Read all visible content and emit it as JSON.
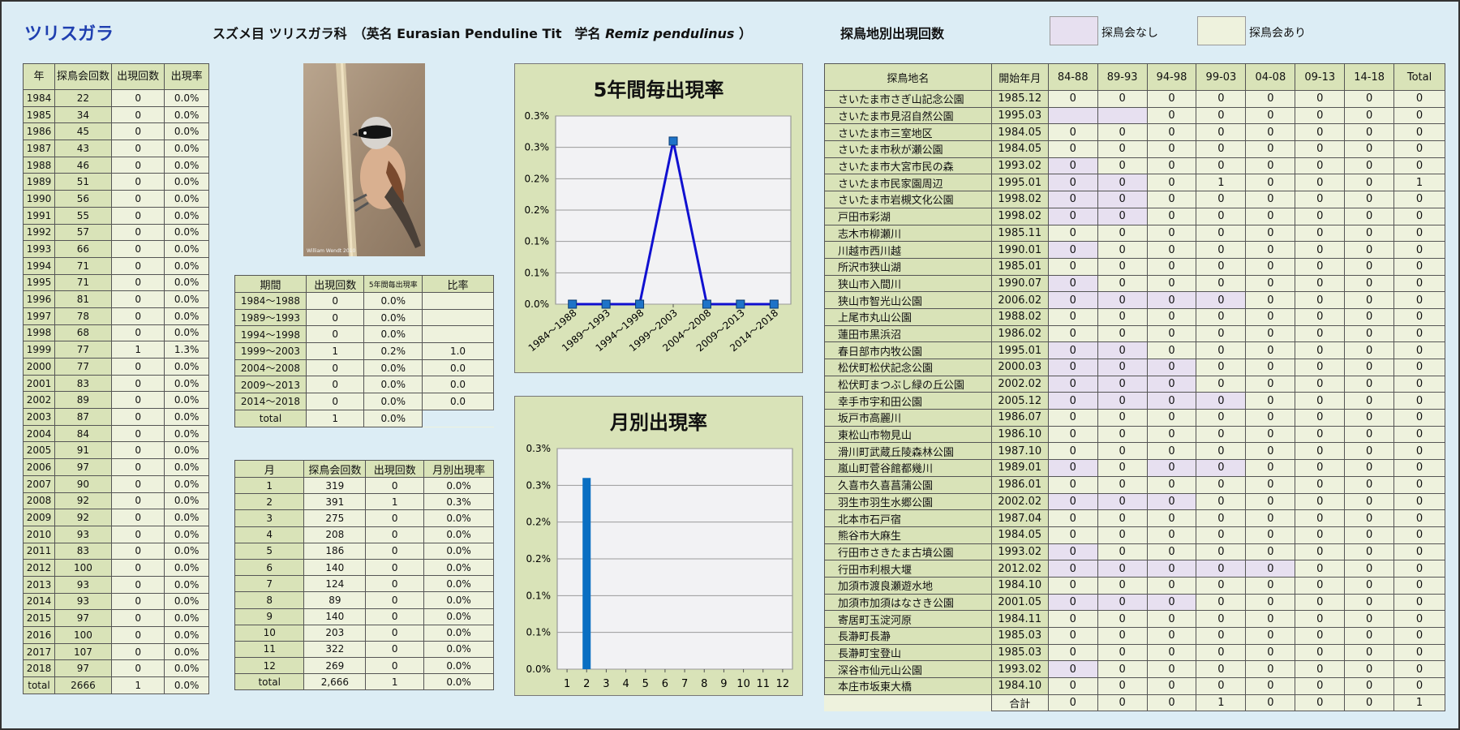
{
  "header": {
    "title": "ツリスガラ",
    "species_prefix": "スズメ目 ツリスガラ科　（英名 Eurasian Penduline Tit　学名",
    "species_latin": "Remiz pendulinus",
    "species_suffix": "）",
    "sites_title": "探鳥地別出現回数",
    "legend_none": "探鳥会なし",
    "legend_yes": "探鳥会あり"
  },
  "colors": {
    "bg": "#dcedf5",
    "cell": "#eef2dd",
    "header": "#d9e3b8",
    "none": "#e7e0f0",
    "line": "#1010d0",
    "bar": "#0a6fc2"
  },
  "photo": {
    "credit": "William Wendt 2010"
  },
  "years_table": {
    "headers": [
      "年",
      "探鳥会回数",
      "出現回数",
      "出現率"
    ],
    "rows": [
      [
        "1984",
        "22",
        "0",
        "0.0%"
      ],
      [
        "1985",
        "34",
        "0",
        "0.0%"
      ],
      [
        "1986",
        "45",
        "0",
        "0.0%"
      ],
      [
        "1987",
        "43",
        "0",
        "0.0%"
      ],
      [
        "1988",
        "46",
        "0",
        "0.0%"
      ],
      [
        "1989",
        "51",
        "0",
        "0.0%"
      ],
      [
        "1990",
        "56",
        "0",
        "0.0%"
      ],
      [
        "1991",
        "55",
        "0",
        "0.0%"
      ],
      [
        "1992",
        "57",
        "0",
        "0.0%"
      ],
      [
        "1993",
        "66",
        "0",
        "0.0%"
      ],
      [
        "1994",
        "71",
        "0",
        "0.0%"
      ],
      [
        "1995",
        "71",
        "0",
        "0.0%"
      ],
      [
        "1996",
        "81",
        "0",
        "0.0%"
      ],
      [
        "1997",
        "78",
        "0",
        "0.0%"
      ],
      [
        "1998",
        "68",
        "0",
        "0.0%"
      ],
      [
        "1999",
        "77",
        "1",
        "1.3%"
      ],
      [
        "2000",
        "77",
        "0",
        "0.0%"
      ],
      [
        "2001",
        "83",
        "0",
        "0.0%"
      ],
      [
        "2002",
        "89",
        "0",
        "0.0%"
      ],
      [
        "2003",
        "87",
        "0",
        "0.0%"
      ],
      [
        "2004",
        "84",
        "0",
        "0.0%"
      ],
      [
        "2005",
        "91",
        "0",
        "0.0%"
      ],
      [
        "2006",
        "97",
        "0",
        "0.0%"
      ],
      [
        "2007",
        "90",
        "0",
        "0.0%"
      ],
      [
        "2008",
        "92",
        "0",
        "0.0%"
      ],
      [
        "2009",
        "92",
        "0",
        "0.0%"
      ],
      [
        "2010",
        "93",
        "0",
        "0.0%"
      ],
      [
        "2011",
        "83",
        "0",
        "0.0%"
      ],
      [
        "2012",
        "100",
        "0",
        "0.0%"
      ],
      [
        "2013",
        "93",
        "0",
        "0.0%"
      ],
      [
        "2014",
        "93",
        "0",
        "0.0%"
      ],
      [
        "2015",
        "97",
        "0",
        "0.0%"
      ],
      [
        "2016",
        "100",
        "0",
        "0.0%"
      ],
      [
        "2017",
        "107",
        "0",
        "0.0%"
      ],
      [
        "2018",
        "97",
        "0",
        "0.0%"
      ],
      [
        "total",
        "2666",
        "1",
        "0.0%"
      ]
    ]
  },
  "period_table": {
    "headers": [
      "期間",
      "出現回数",
      "5年間毎出現率",
      "比率"
    ],
    "rows": [
      [
        "1984～1988",
        "0",
        "0.0%",
        ""
      ],
      [
        "1989～1993",
        "0",
        "0.0%",
        ""
      ],
      [
        "1994～1998",
        "0",
        "0.0%",
        ""
      ],
      [
        "1999～2003",
        "1",
        "0.2%",
        "1.0"
      ],
      [
        "2004～2008",
        "0",
        "0.0%",
        "0.0"
      ],
      [
        "2009～2013",
        "0",
        "0.0%",
        "0.0"
      ],
      [
        "2014～2018",
        "0",
        "0.0%",
        "0.0"
      ]
    ],
    "total": [
      "total",
      "1",
      "0.0%"
    ]
  },
  "month_table": {
    "headers": [
      "月",
      "探鳥会回数",
      "出現回数",
      "月別出現率"
    ],
    "rows": [
      [
        "1",
        "319",
        "0",
        "0.0%"
      ],
      [
        "2",
        "391",
        "1",
        "0.3%"
      ],
      [
        "3",
        "275",
        "0",
        "0.0%"
      ],
      [
        "4",
        "208",
        "0",
        "0.0%"
      ],
      [
        "5",
        "186",
        "0",
        "0.0%"
      ],
      [
        "6",
        "140",
        "0",
        "0.0%"
      ],
      [
        "7",
        "124",
        "0",
        "0.0%"
      ],
      [
        "8",
        "89",
        "0",
        "0.0%"
      ],
      [
        "9",
        "140",
        "0",
        "0.0%"
      ],
      [
        "10",
        "203",
        "0",
        "0.0%"
      ],
      [
        "11",
        "322",
        "0",
        "0.0%"
      ],
      [
        "12",
        "269",
        "0",
        "0.0%"
      ],
      [
        "total",
        "2,666",
        "1",
        "0.0%"
      ]
    ]
  },
  "sites_table": {
    "headers": [
      "探鳥地名",
      "開始年月",
      "84-88",
      "89-93",
      "94-98",
      "99-03",
      "04-08",
      "09-13",
      "14-18",
      "Total"
    ],
    "rows": [
      {
        "name": "さいたま市さぎ山記念公園",
        "start": "1985.12",
        "vals": [
          "0",
          "0",
          "0",
          "0",
          "0",
          "0",
          "0",
          "0"
        ],
        "none": []
      },
      {
        "name": "さいたま市見沼自然公園",
        "start": "1995.03",
        "vals": [
          "",
          "",
          "0",
          "0",
          "0",
          "0",
          "0",
          "0"
        ],
        "none": [
          0,
          1
        ]
      },
      {
        "name": "さいたま市三室地区",
        "start": "1984.05",
        "vals": [
          "0",
          "0",
          "0",
          "0",
          "0",
          "0",
          "0",
          "0"
        ],
        "none": []
      },
      {
        "name": "さいたま市秋が瀬公園",
        "start": "1984.05",
        "vals": [
          "0",
          "0",
          "0",
          "0",
          "0",
          "0",
          "0",
          "0"
        ],
        "none": []
      },
      {
        "name": "さいたま市大宮市民の森",
        "start": "1993.02",
        "vals": [
          "0",
          "0",
          "0",
          "0",
          "0",
          "0",
          "0",
          "0"
        ],
        "none": [
          0
        ]
      },
      {
        "name": "さいたま市民家園周辺",
        "start": "1995.01",
        "vals": [
          "0",
          "0",
          "0",
          "1",
          "0",
          "0",
          "0",
          "1"
        ],
        "none": [
          0,
          1
        ]
      },
      {
        "name": "さいたま市岩槻文化公園",
        "start": "1998.02",
        "vals": [
          "0",
          "0",
          "0",
          "0",
          "0",
          "0",
          "0",
          "0"
        ],
        "none": [
          0,
          1
        ]
      },
      {
        "name": "戸田市彩湖",
        "start": "1998.02",
        "vals": [
          "0",
          "0",
          "0",
          "0",
          "0",
          "0",
          "0",
          "0"
        ],
        "none": [
          0,
          1
        ]
      },
      {
        "name": "志木市柳瀬川",
        "start": "1985.11",
        "vals": [
          "0",
          "0",
          "0",
          "0",
          "0",
          "0",
          "0",
          "0"
        ],
        "none": []
      },
      {
        "name": "川越市西川越",
        "start": "1990.01",
        "vals": [
          "0",
          "0",
          "0",
          "0",
          "0",
          "0",
          "0",
          "0"
        ],
        "none": [
          0
        ]
      },
      {
        "name": "所沢市狭山湖",
        "start": "1985.01",
        "vals": [
          "0",
          "0",
          "0",
          "0",
          "0",
          "0",
          "0",
          "0"
        ],
        "none": []
      },
      {
        "name": "狭山市入間川",
        "start": "1990.07",
        "vals": [
          "0",
          "0",
          "0",
          "0",
          "0",
          "0",
          "0",
          "0"
        ],
        "none": [
          0
        ]
      },
      {
        "name": "狭山市智光山公園",
        "start": "2006.02",
        "vals": [
          "0",
          "0",
          "0",
          "0",
          "0",
          "0",
          "0",
          "0"
        ],
        "none": [
          0,
          1,
          2,
          3
        ]
      },
      {
        "name": "上尾市丸山公園",
        "start": "1988.02",
        "vals": [
          "0",
          "0",
          "0",
          "0",
          "0",
          "0",
          "0",
          "0"
        ],
        "none": []
      },
      {
        "name": "蓮田市黒浜沼",
        "start": "1986.02",
        "vals": [
          "0",
          "0",
          "0",
          "0",
          "0",
          "0",
          "0",
          "0"
        ],
        "none": []
      },
      {
        "name": "春日部市内牧公園",
        "start": "1995.01",
        "vals": [
          "0",
          "0",
          "0",
          "0",
          "0",
          "0",
          "0",
          "0"
        ],
        "none": [
          0,
          1
        ]
      },
      {
        "name": "松伏町松伏記念公園",
        "start": "2000.03",
        "vals": [
          "0",
          "0",
          "0",
          "0",
          "0",
          "0",
          "0",
          "0"
        ],
        "none": [
          0,
          1,
          2
        ]
      },
      {
        "name": "松伏町まつぶし緑の丘公園",
        "start": "2002.02",
        "vals": [
          "0",
          "0",
          "0",
          "0",
          "0",
          "0",
          "0",
          "0"
        ],
        "none": [
          0,
          1,
          2
        ]
      },
      {
        "name": "幸手市宇和田公園",
        "start": "2005.12",
        "vals": [
          "0",
          "0",
          "0",
          "0",
          "0",
          "0",
          "0",
          "0"
        ],
        "none": [
          0,
          1,
          2,
          3
        ]
      },
      {
        "name": "坂戸市高麗川",
        "start": "1986.07",
        "vals": [
          "0",
          "0",
          "0",
          "0",
          "0",
          "0",
          "0",
          "0"
        ],
        "none": []
      },
      {
        "name": "東松山市物見山",
        "start": "1986.10",
        "vals": [
          "0",
          "0",
          "0",
          "0",
          "0",
          "0",
          "0",
          "0"
        ],
        "none": []
      },
      {
        "name": "滑川町武蔵丘陵森林公園",
        "start": "1987.10",
        "vals": [
          "0",
          "0",
          "0",
          "0",
          "0",
          "0",
          "0",
          "0"
        ],
        "none": []
      },
      {
        "name": "嵐山町菅谷館都幾川",
        "start": "1989.01",
        "vals": [
          "0",
          "0",
          "0",
          "0",
          "0",
          "0",
          "0",
          "0"
        ],
        "none": [
          0,
          2,
          3
        ]
      },
      {
        "name": "久喜市久喜菖蒲公園",
        "start": "1986.01",
        "vals": [
          "0",
          "0",
          "0",
          "0",
          "0",
          "0",
          "0",
          "0"
        ],
        "none": []
      },
      {
        "name": "羽生市羽生水郷公園",
        "start": "2002.02",
        "vals": [
          "0",
          "0",
          "0",
          "0",
          "0",
          "0",
          "0",
          "0"
        ],
        "none": [
          0,
          1,
          2
        ]
      },
      {
        "name": "北本市石戸宿",
        "start": "1987.04",
        "vals": [
          "0",
          "0",
          "0",
          "0",
          "0",
          "0",
          "0",
          "0"
        ],
        "none": []
      },
      {
        "name": "熊谷市大麻生",
        "start": "1984.05",
        "vals": [
          "0",
          "0",
          "0",
          "0",
          "0",
          "0",
          "0",
          "0"
        ],
        "none": []
      },
      {
        "name": "行田市さきたま古墳公園",
        "start": "1993.02",
        "vals": [
          "0",
          "0",
          "0",
          "0",
          "0",
          "0",
          "0",
          "0"
        ],
        "none": [
          0
        ]
      },
      {
        "name": "行田市利根大堰",
        "start": "2012.02",
        "vals": [
          "0",
          "0",
          "0",
          "0",
          "0",
          "0",
          "0",
          "0"
        ],
        "none": [
          0,
          1,
          2,
          3,
          4
        ]
      },
      {
        "name": "加須市渡良瀬遊水地",
        "start": "1984.10",
        "vals": [
          "0",
          "0",
          "0",
          "0",
          "0",
          "0",
          "0",
          "0"
        ],
        "none": []
      },
      {
        "name": "加須市加須はなさき公園",
        "start": "2001.05",
        "vals": [
          "0",
          "0",
          "0",
          "0",
          "0",
          "0",
          "0",
          "0"
        ],
        "none": [
          0,
          1,
          2
        ]
      },
      {
        "name": "寄居町玉淀河原",
        "start": "1984.11",
        "vals": [
          "0",
          "0",
          "0",
          "0",
          "0",
          "0",
          "0",
          "0"
        ],
        "none": []
      },
      {
        "name": "長瀞町長瀞",
        "start": "1985.03",
        "vals": [
          "0",
          "0",
          "0",
          "0",
          "0",
          "0",
          "0",
          "0"
        ],
        "none": []
      },
      {
        "name": "長瀞町宝登山",
        "start": "1985.03",
        "vals": [
          "0",
          "0",
          "0",
          "0",
          "0",
          "0",
          "0",
          "0"
        ],
        "none": []
      },
      {
        "name": "深谷市仙元山公園",
        "start": "1993.02",
        "vals": [
          "0",
          "0",
          "0",
          "0",
          "0",
          "0",
          "0",
          "0"
        ],
        "none": [
          0
        ]
      },
      {
        "name": "本庄市坂東大橋",
        "start": "1984.10",
        "vals": [
          "0",
          "0",
          "0",
          "0",
          "0",
          "0",
          "0",
          "0"
        ],
        "none": []
      }
    ],
    "total": {
      "label": "合計",
      "vals": [
        "0",
        "0",
        "0",
        "1",
        "0",
        "0",
        "0",
        "1"
      ]
    }
  },
  "chart_data": [
    {
      "type": "line",
      "title": "5年間毎出現率",
      "categories": [
        "1984～1988",
        "1989～1993",
        "1994～1998",
        "1999～2003",
        "2004～2008",
        "2009～2013",
        "2014～2018"
      ],
      "values": [
        0,
        0,
        0,
        0.26,
        0,
        0,
        0
      ],
      "yticks": [
        "0.0%",
        "0.1%",
        "0.1%",
        "0.2%",
        "0.2%",
        "0.3%",
        "0.3%"
      ],
      "ylim": [
        0,
        0.3
      ],
      "grid": true
    },
    {
      "type": "bar",
      "title": "月別出現率",
      "categories": [
        "1",
        "2",
        "3",
        "4",
        "5",
        "6",
        "7",
        "8",
        "9",
        "10",
        "11",
        "12"
      ],
      "values": [
        0,
        0.26,
        0,
        0,
        0,
        0,
        0,
        0,
        0,
        0,
        0,
        0
      ],
      "yticks": [
        "0.0%",
        "0.1%",
        "0.1%",
        "0.2%",
        "0.2%",
        "0.3%",
        "0.3%"
      ],
      "ylim": [
        0,
        0.3
      ],
      "grid": true
    }
  ]
}
